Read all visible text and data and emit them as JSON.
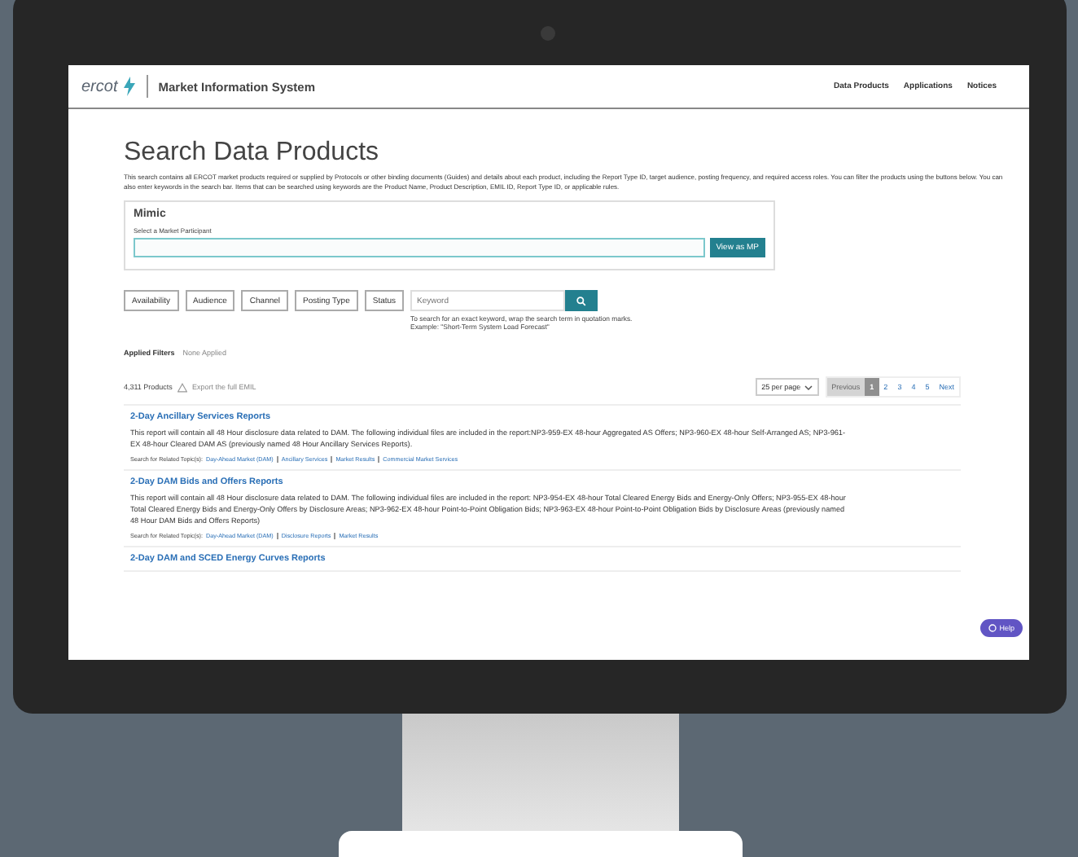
{
  "header": {
    "logo": "ercot",
    "title": "Market Information System",
    "nav": [
      "Data Products",
      "Applications",
      "Notices"
    ]
  },
  "page": {
    "title": "Search Data Products",
    "description": "This search contains all ERCOT market products required or supplied by Protocols or other binding documents (Guides) and details about each product, including the Report Type ID, target audience, posting frequency, and required access roles. You can filter the products using the buttons below. You can also enter keywords in the search bar. Items that can be searched using keywords are the Product Name, Product Description, EMIL ID, Report Type ID, or applicable rules."
  },
  "mimic": {
    "title": "Mimic",
    "label": "Select a Market Participant",
    "button": "View as MP"
  },
  "filters": [
    "Availability",
    "Audience",
    "Channel",
    "Posting Type",
    "Status"
  ],
  "search": {
    "placeholder": "Keyword",
    "hint": "To search for an exact keyword, wrap the search term in quotation marks. Example: \"Short-Term System Load Forecast\""
  },
  "applied_filters": {
    "label": "Applied Filters",
    "value": "None Applied"
  },
  "results": {
    "count": "4,311 Products",
    "export": "Export the full EMIL",
    "per_page": "25 per page",
    "pages": [
      {
        "label": "Previous",
        "selected": false,
        "disabled": true
      },
      {
        "label": "1",
        "selected": true,
        "disabled": false
      },
      {
        "label": "2",
        "selected": false,
        "disabled": false
      },
      {
        "label": "3",
        "selected": false,
        "disabled": false
      },
      {
        "label": "4",
        "selected": false,
        "disabled": false
      },
      {
        "label": "5",
        "selected": false,
        "disabled": false
      },
      {
        "label": "Next",
        "selected": false,
        "disabled": false
      }
    ]
  },
  "products": [
    {
      "title": "2-Day Ancillary Services Reports",
      "description": "This report will contain all 48 Hour disclosure data related to DAM. The following individual files are included in the report:NP3-959-EX 48-hour Aggregated AS Offers; NP3-960-EX 48-hour Self-Arranged AS; NP3-961-EX 48-hour Cleared DAM AS (previously named 48 Hour Ancillary Services Reports).",
      "topics_label": "Search for Related Topic(s):",
      "topics": [
        "Day-Ahead Market (DAM)",
        "Ancillary Services",
        "Market Results",
        "Commercial Market Services"
      ]
    },
    {
      "title": "2-Day DAM Bids and Offers Reports",
      "description": "This report will contain all 48 Hour disclosure data related to DAM. The following individual files are included in the report: NP3-954-EX 48-hour Total Cleared Energy Bids and Energy-Only Offers; NP3-955-EX 48-hour Total Cleared Energy Bids and Energy-Only Offers by Disclosure Areas; NP3-962-EX 48-hour Point-to-Point Obligation Bids; NP3-963-EX 48-hour Point-to-Point Obligation Bids by Disclosure Areas (previously named 48 Hour DAM Bids and Offers Reports)",
      "topics_label": "Search for Related Topic(s):",
      "topics": [
        "Day-Ahead Market (DAM)",
        "Disclosure Reports",
        "Market Results"
      ]
    },
    {
      "title": "2-Day DAM and SCED Energy Curves Reports"
    }
  ],
  "help": "Help"
}
